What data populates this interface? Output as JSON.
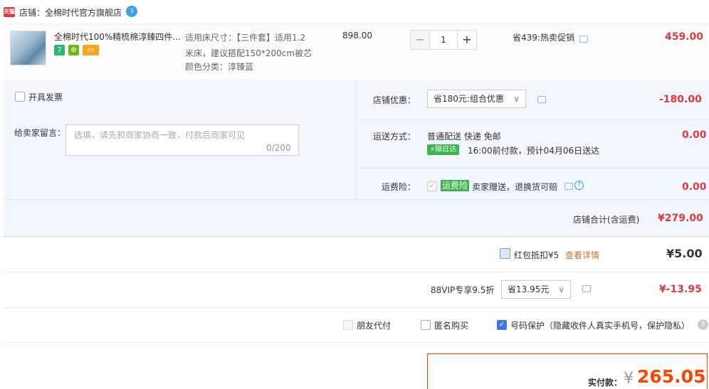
{
  "shop": {
    "logo_text": "天猫",
    "label": "店铺：全棉时代官方旗舰店",
    "ww_text": "3"
  },
  "item": {
    "title": "全棉时代100%精梳棉淳臻四件...",
    "badges": [
      "7",
      "⊕",
      "▭"
    ],
    "sku_lines": [
      "适用床尺寸：【三件套】适用1.2",
      "米床，建议搭配150*200cm被芯",
      "颜色分类：淳臻蓝"
    ],
    "price": "898.00",
    "qty_minus": "−",
    "qty": "1",
    "qty_plus": "+",
    "promo": "省439:热卖促销",
    "subtotal": "459.00"
  },
  "invoice": {
    "label": "开具发票"
  },
  "memo": {
    "label": "给卖家留言：",
    "placeholder": "选填，请先和商家协商一致，付款后商家可见",
    "counter": "0/200"
  },
  "shop_discount": {
    "label": "店铺优惠：",
    "selected": "省180元:组合优惠",
    "amount": "-180.00"
  },
  "delivery": {
    "label": "运送方式：",
    "method": "普通配送 快递 免邮",
    "badge": "隔日达",
    "eta": "16:00前付款，预计04月06日送达",
    "amount": "0.00"
  },
  "insurance": {
    "label": "运费险：",
    "badge": "运费险",
    "text": "卖家赠送，退换货可赔",
    "help": "?",
    "amount": "0.00"
  },
  "shop_total": {
    "label": "店铺合计(含运费)",
    "amount": "¥279.00"
  },
  "red_packet": {
    "label": "红包抵扣¥5",
    "link": "查看详情",
    "amount": "¥5.00"
  },
  "vip": {
    "label": "88VIP专享9.5折",
    "selected": "省13.95元",
    "amount": "¥-13.95"
  },
  "options": {
    "friend_pay": "朋友代付",
    "anonymous": "匿名购买",
    "number_protect": "号码保护（隐藏收件人真实手机号，保护隐私）",
    "help": "?"
  },
  "payment": {
    "label": "实付款：",
    "currency": "¥",
    "amount": "265.05"
  },
  "colors": {
    "accent": "#e4393c",
    "pay_red": "#ff4400",
    "panel_bg": "#f2f7ff",
    "link": "#3399ff"
  }
}
